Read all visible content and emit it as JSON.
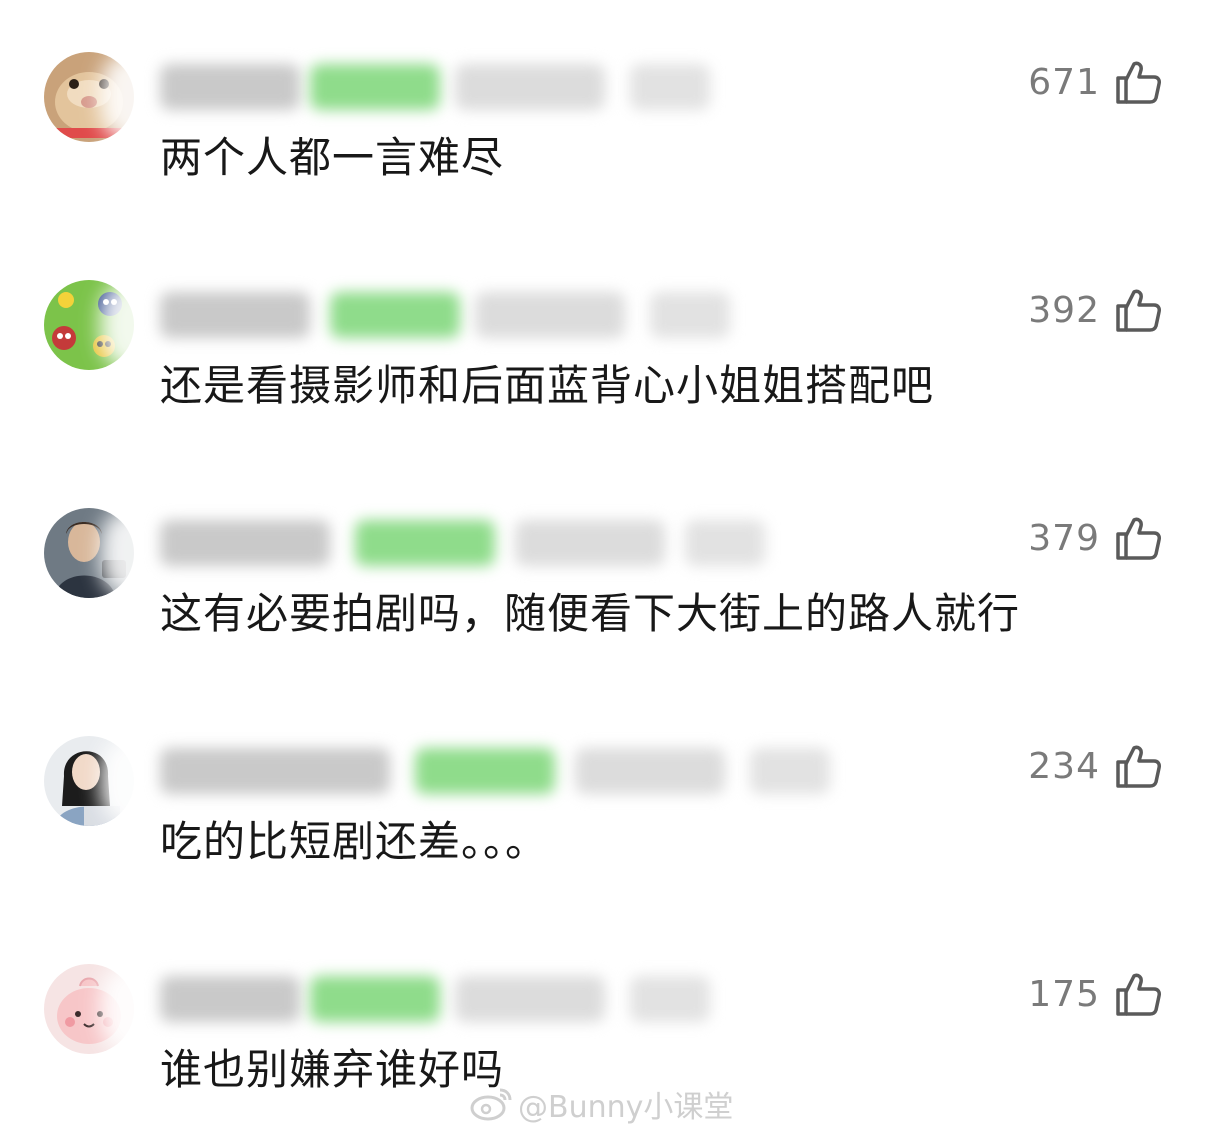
{
  "comments": [
    {
      "text": "两个人都一言难尽",
      "likes": "671",
      "avatar_icon": "hamster-avatar"
    },
    {
      "text": "还是看摄影师和后面蓝背心小姐姐搭配吧",
      "likes": "392",
      "avatar_icon": "cartoon-creatures-avatar"
    },
    {
      "text": "这有必要拍剧吗，随便看下大街上的路人就行",
      "likes": "379",
      "avatar_icon": "pilot-avatar"
    },
    {
      "text": "吃的比短剧还差。。。",
      "likes": "234",
      "avatar_icon": "woman-portrait-avatar"
    },
    {
      "text": "谁也别嫌弃谁好吗",
      "likes": "175",
      "avatar_icon": "pink-cartoon-avatar"
    }
  ],
  "like_icon": "thumbs-up-icon",
  "watermark": {
    "text": "@Bunny小课堂",
    "icon": "weibo-icon"
  },
  "colors": {
    "comment_text": "#181818",
    "like_count": "#7a7a7a",
    "badge_blur": "#8fdc8b",
    "watermark": "#cfcfcf"
  }
}
